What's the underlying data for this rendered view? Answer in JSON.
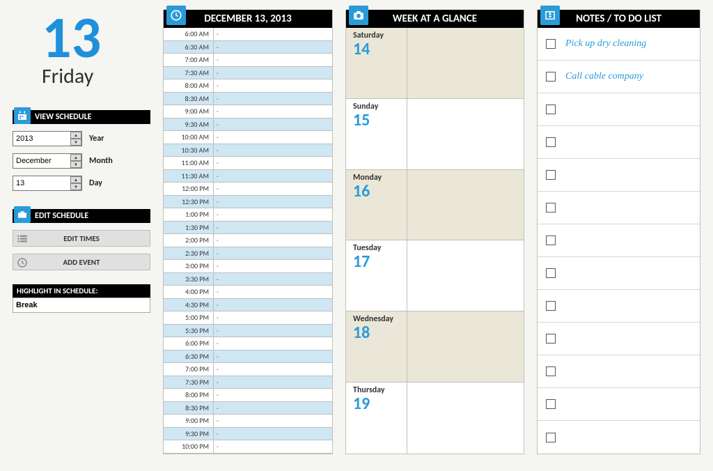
{
  "date": {
    "number": "13",
    "day": "Friday"
  },
  "viewSchedule": {
    "heading": "VIEW SCHEDULE",
    "fields": {
      "year": {
        "value": "2013",
        "label": "Year"
      },
      "month": {
        "value": "December",
        "label": "Month"
      },
      "day": {
        "value": "13",
        "label": "Day"
      }
    }
  },
  "editSchedule": {
    "heading": "EDIT SCHEDULE",
    "buttons": {
      "editTimes": "EDIT TIMES",
      "addEvent": "ADD EVENT"
    }
  },
  "highlight": {
    "heading": "HIGHLIGHT IN SCHEDULE:",
    "value": "Break"
  },
  "schedule": {
    "heading": "DECEMBER 13, 2013",
    "slots": [
      {
        "t": "6:00 AM",
        "v": "-"
      },
      {
        "t": "6:30 AM",
        "v": "-"
      },
      {
        "t": "7:00 AM",
        "v": "-"
      },
      {
        "t": "7:30 AM",
        "v": "-"
      },
      {
        "t": "8:00 AM",
        "v": "-"
      },
      {
        "t": "8:30 AM",
        "v": "-"
      },
      {
        "t": "9:00 AM",
        "v": "-"
      },
      {
        "t": "9:30 AM",
        "v": "-"
      },
      {
        "t": "10:00 AM",
        "v": "-"
      },
      {
        "t": "10:30 AM",
        "v": "-"
      },
      {
        "t": "11:00 AM",
        "v": "-"
      },
      {
        "t": "11:30 AM",
        "v": "-"
      },
      {
        "t": "12:00 PM",
        "v": "-"
      },
      {
        "t": "12:30 PM",
        "v": "-"
      },
      {
        "t": "1:00 PM",
        "v": "-"
      },
      {
        "t": "1:30 PM",
        "v": "-"
      },
      {
        "t": "2:00 PM",
        "v": "-"
      },
      {
        "t": "2:30 PM",
        "v": "-"
      },
      {
        "t": "3:00 PM",
        "v": "-"
      },
      {
        "t": "3:30 PM",
        "v": "-"
      },
      {
        "t": "4:00 PM",
        "v": "-"
      },
      {
        "t": "4:30 PM",
        "v": "-"
      },
      {
        "t": "5:00 PM",
        "v": "-"
      },
      {
        "t": "5:30 PM",
        "v": "-"
      },
      {
        "t": "6:00 PM",
        "v": "-"
      },
      {
        "t": "6:30 PM",
        "v": "-"
      },
      {
        "t": "7:00 PM",
        "v": "-"
      },
      {
        "t": "7:30 PM",
        "v": "-"
      },
      {
        "t": "8:00 PM",
        "v": "-"
      },
      {
        "t": "8:30 PM",
        "v": "-"
      },
      {
        "t": "9:00 PM",
        "v": "-"
      },
      {
        "t": "9:30 PM",
        "v": "-"
      },
      {
        "t": "10:00 PM",
        "v": "-"
      }
    ]
  },
  "week": {
    "heading": "WEEK AT A GLANCE",
    "days": [
      {
        "name": "Saturday",
        "num": "14"
      },
      {
        "name": "Sunday",
        "num": "15"
      },
      {
        "name": "Monday",
        "num": "16"
      },
      {
        "name": "Tuesday",
        "num": "17"
      },
      {
        "name": "Wednesday",
        "num": "18"
      },
      {
        "name": "Thursday",
        "num": "19"
      }
    ]
  },
  "notes": {
    "heading": "NOTES / TO DO LIST",
    "items": [
      "Pick up dry cleaning",
      "Call cable company",
      "",
      "",
      "",
      "",
      "",
      "",
      "",
      "",
      "",
      "",
      ""
    ]
  }
}
